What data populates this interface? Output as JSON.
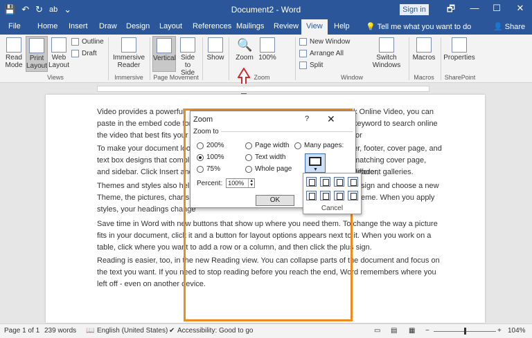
{
  "window": {
    "title": "Document2 - Word",
    "signin": "Sign in",
    "qat": [
      "💾",
      "↶",
      "↻",
      "ab",
      "⌄"
    ],
    "controls": [
      "🗗",
      "—",
      "☐",
      "✕"
    ]
  },
  "tabs": [
    "File",
    "Home",
    "Insert",
    "Draw",
    "Design",
    "Layout",
    "References",
    "Mailings",
    "Review",
    "View",
    "Help"
  ],
  "active_tab": "View",
  "tellme": "Tell me what you want to do",
  "share": "Share",
  "ribbon": {
    "views": {
      "read_mode": "Read Mode",
      "print_layout": "Print Layout",
      "web_layout": "Web Layout",
      "outline": "Outline",
      "draft": "Draft",
      "label": "Views"
    },
    "immersive": {
      "reader": "Immersive Reader",
      "label": "Immersive"
    },
    "page_movement": {
      "vertical": "Vertical",
      "side": "Side to Side",
      "label": "Page Movement"
    },
    "show": "Show",
    "zoom": {
      "zoom": "Zoom",
      "hundred": "100%",
      "label": "Zoom"
    },
    "window": {
      "new_window": "New Window",
      "arrange_all": "Arrange All",
      "split": "Split",
      "switch_windows": "Switch Windows",
      "label": "Window"
    },
    "macros": {
      "macros": "Macros",
      "label": "Macros"
    },
    "sharepoint": {
      "properties": "Properties",
      "label": "SharePoint"
    }
  },
  "document": {
    "paragraphs": [
      [
        "Video provides a powerful",
        "k Online Video, you can",
        "paste in the embed code for",
        "keyword to search online for",
        "the video that best fits your"
      ],
      [
        "To make your document loo",
        "er, footer, cover page, and",
        "text box designs that compl",
        "matching cover page, header,",
        "and sidebar. Click Insert and",
        "different galleries."
      ],
      [
        "Themes and styles also help",
        "sign and choose a new",
        "Theme, the pictures, charts,",
        "eme. When you apply",
        "styles, your headings change"
      ],
      [
        "Save time in Word with new buttons that show up where you need them. To change the way a picture",
        "fits in your document, click it and a button for layout options appears next to it. When you work on a",
        "table, click where you want to add a row or a column, and then click the plus sign."
      ],
      [
        "Reading is easier, too, in the new Reading view. You can collapse parts of the document and focus on",
        "the text you want. If you need to stop reading before you reach the end, Word remembers where you",
        "left off - even on another device."
      ]
    ]
  },
  "dialog": {
    "title": "Zoom",
    "help": "?",
    "close": "✕",
    "zoom_to": "Zoom to",
    "options": {
      "p200": "200%",
      "p100": "100%",
      "p75": "75%",
      "page_width": "Page width",
      "text_width": "Text width",
      "whole_page": "Whole page",
      "many_pages": "Many pages:"
    },
    "selected": "100%",
    "percent_label": "Percent:",
    "percent_value": "100%",
    "ok": "OK"
  },
  "pages_popup": {
    "cancel": "Cancel"
  },
  "status": {
    "page": "Page 1 of 1",
    "words": "239 words",
    "language": "English (United States)",
    "accessibility": "Accessibility: Good to go",
    "zoom": "104%"
  },
  "colors": {
    "brand": "#2b579a",
    "highlight": "#f08a1d",
    "arrow": "#d6282a"
  }
}
